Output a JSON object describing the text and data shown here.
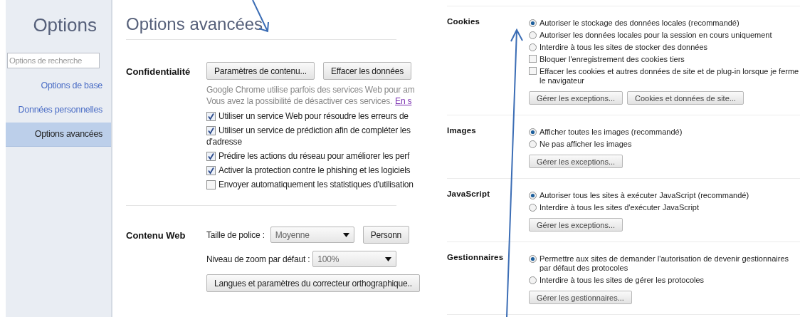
{
  "left": {
    "sidebar": {
      "title": "Options",
      "search": {
        "placeholder": "Options de recherche"
      },
      "items": [
        {
          "label": "Options de base",
          "selected": false
        },
        {
          "label": "Données personnelles",
          "selected": false
        },
        {
          "label": "Options avancées",
          "selected": true
        }
      ]
    },
    "page_title": "Options avancées",
    "privacy": {
      "label": "Confidentialité",
      "buttons": [
        "Paramètres de contenu...",
        "Effacer les données"
      ],
      "description": {
        "lines": [
          "Google Chrome utilise parfois des services Web pour am",
          "Vous avez la possibilité de désactiver ces services."
        ],
        "link": "En s"
      },
      "checkboxes": [
        {
          "label": "Utiliser un service Web pour résoudre les erreurs de",
          "checked": true
        },
        {
          "label": "Utiliser un service de prédiction afin de compléter les",
          "continuation": "d'adresse",
          "checked": true
        },
        {
          "label": "Prédire les actions du réseau pour améliorer les perf",
          "checked": true
        },
        {
          "label": "Activer la protection contre le phishing et les logiciels",
          "checked": true
        },
        {
          "label": "Envoyer automatiquement les statistiques d'utilisation",
          "checked": false
        }
      ]
    },
    "web_content": {
      "label": "Contenu Web",
      "font_size": {
        "label": "Taille de police :",
        "value": "Moyenne"
      },
      "customize_button": "Personn",
      "zoom": {
        "label": "Niveau de zoom par défaut :",
        "value": "100%"
      },
      "languages_button": "Langues et paramètres du correcteur orthographique.."
    }
  },
  "right": {
    "sections": [
      {
        "label": "Cookies",
        "options": [
          {
            "kind": "radio",
            "label": "Autoriser le stockage des données locales (recommandé)",
            "selected": true
          },
          {
            "kind": "radio",
            "label": "Autoriser les données locales pour la session en cours uniquement",
            "selected": false
          },
          {
            "kind": "radio",
            "label": "Interdire à tous les sites de stocker des données",
            "selected": false
          },
          {
            "kind": "checkbox",
            "label": "Bloquer l'enregistrement des cookies tiers",
            "checked": false
          },
          {
            "kind": "checkbox",
            "label": "Effacer les cookies et autres données de site et de plug-in lorsque je ferme le navigateur",
            "checked": false
          }
        ],
        "buttons": [
          "Gérer les exceptions...",
          "Cookies et données de site..."
        ]
      },
      {
        "label": "Images",
        "options": [
          {
            "kind": "radio",
            "label": "Afficher toutes les images (recommandé)",
            "selected": true
          },
          {
            "kind": "radio",
            "label": "Ne pas afficher les images",
            "selected": false
          }
        ],
        "buttons": [
          "Gérer les exceptions..."
        ]
      },
      {
        "label": "JavaScript",
        "options": [
          {
            "kind": "radio",
            "label": "Autoriser tous les sites à exécuter JavaScript (recommandé)",
            "selected": true
          },
          {
            "kind": "radio",
            "label": "Interdire à tous les sites d'exécuter JavaScript",
            "selected": false
          }
        ],
        "buttons": [
          "Gérer les exceptions..."
        ]
      },
      {
        "label": "Gestionnaires",
        "options": [
          {
            "kind": "radio",
            "label": "Permettre aux sites de demander l'autorisation de devenir gestionnaires par défaut des protocoles",
            "selected": true
          },
          {
            "kind": "radio",
            "label": "Interdire à tous les sites de gérer les protocoles",
            "selected": false
          }
        ],
        "buttons": [
          "Gérer les gestionnaires..."
        ]
      }
    ]
  }
}
